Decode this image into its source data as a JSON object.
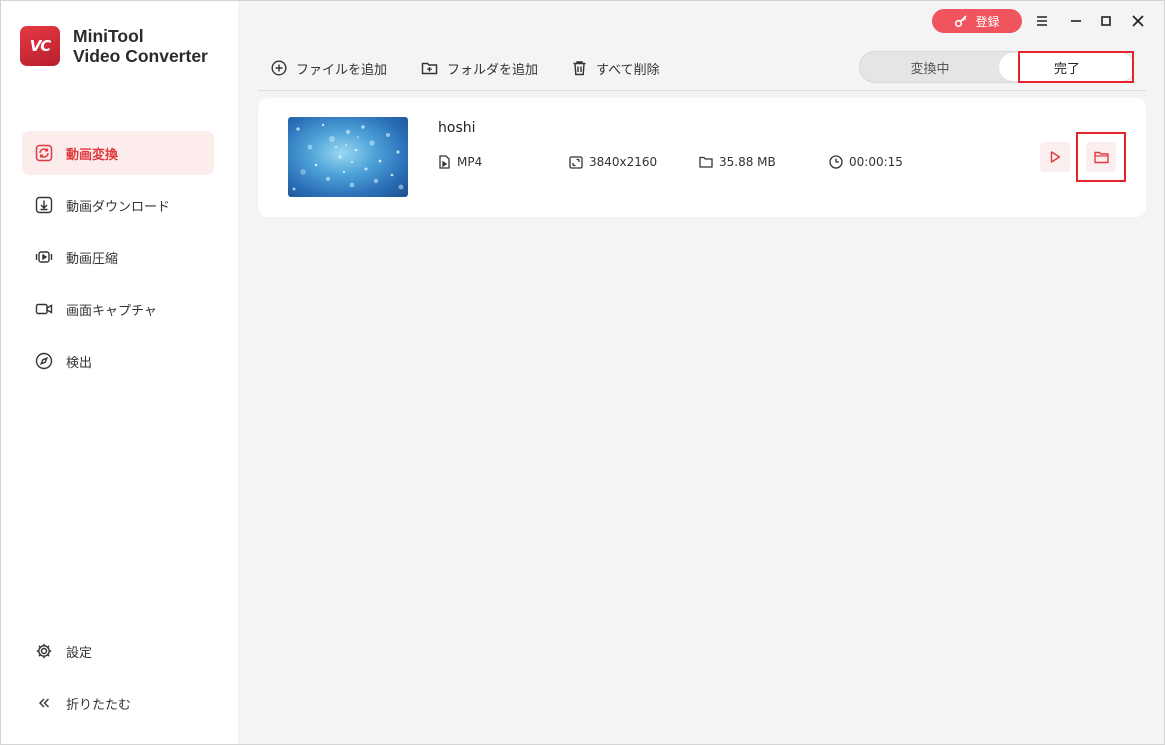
{
  "app": {
    "name_line1": "MiniTool",
    "name_line2": "Video Converter",
    "logo_text": "VC"
  },
  "titlebar": {
    "register_label": "登録"
  },
  "sidebar": {
    "items": [
      {
        "label": "動画変換",
        "icon": "convert-icon",
        "active": true
      },
      {
        "label": "動画ダウンロード",
        "icon": "download-icon",
        "active": false
      },
      {
        "label": "動画圧縮",
        "icon": "compress-icon",
        "active": false
      },
      {
        "label": "画面キャプチャ",
        "icon": "camera-icon",
        "active": false
      },
      {
        "label": "検出",
        "icon": "compass-icon",
        "active": false
      }
    ],
    "bottom": [
      {
        "label": "設定",
        "icon": "gear-icon"
      },
      {
        "label": "折りたたむ",
        "icon": "collapse-icon"
      }
    ]
  },
  "toolbar": {
    "add_file": "ファイルを追加",
    "add_folder": "フォルダを追加",
    "delete_all": "すべて削除"
  },
  "tabs": {
    "converting": "変換中",
    "done": "完了"
  },
  "file": {
    "name": "hoshi",
    "format": "MP4",
    "resolution": "3840x2160",
    "size": "35.88 MB",
    "duration": "00:00:15"
  },
  "colors": {
    "accent": "#e0393f",
    "register_bg": "#f0555f",
    "highlight": "#e4232b"
  }
}
